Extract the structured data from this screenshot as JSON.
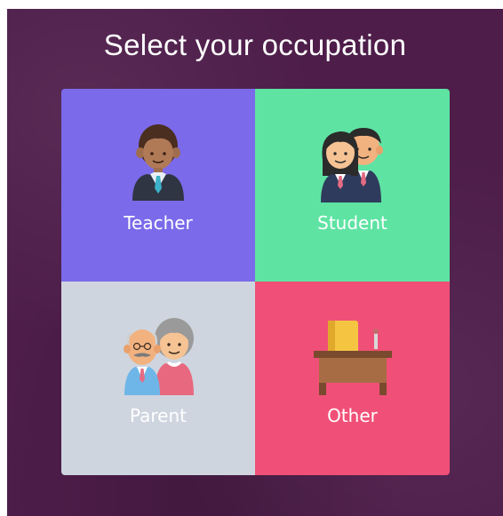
{
  "title": "Select your occupation",
  "tiles": [
    {
      "label": "Teacher",
      "color": "#7b6aea",
      "icon": "teacher-icon"
    },
    {
      "label": "Student",
      "color": "#5ee3a3",
      "icon": "students-icon"
    },
    {
      "label": "Parent",
      "color": "#ced5df",
      "icon": "parents-icon"
    },
    {
      "label": "Other",
      "color": "#f05077",
      "icon": "desk-icon"
    }
  ],
  "colors": {
    "background": "#4e1d4a",
    "title_text": "#ffffff"
  }
}
